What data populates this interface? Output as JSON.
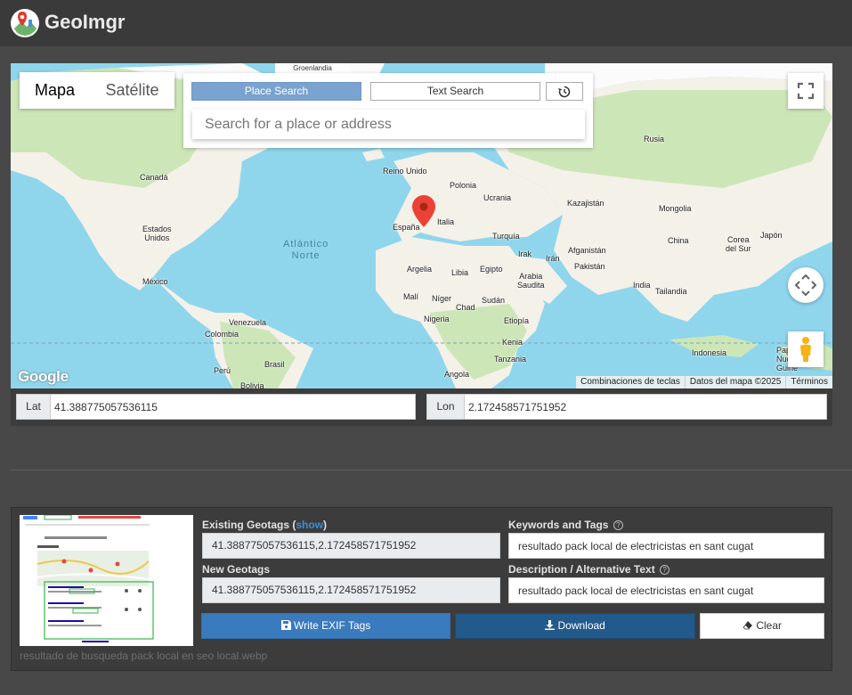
{
  "app": {
    "title": "GeoImgr"
  },
  "map": {
    "map_type": {
      "map": "Mapa",
      "satellite": "Satélite"
    },
    "search": {
      "place_tab": "Place Search",
      "text_tab": "Text Search",
      "history_icon": "history-icon",
      "placeholder": "Search for a place or address"
    },
    "top_label": "Groenlandia",
    "google": "Google",
    "attribution": [
      "Combinaciones de teclas",
      "Datos del mapa ©2025",
      "Términos"
    ],
    "labels": {
      "canada": "Canadá",
      "eeuu": "Estados\nUnidos",
      "mexico": "México",
      "venezuela": "Venezuela",
      "colombia": "Colombia",
      "peru": "Perú",
      "brasil": "Brasil",
      "bolivia": "Bolivia",
      "atlantico": "Atlántico\nNorte",
      "reino_unido": "Reino Unido",
      "polonia": "Polonia",
      "ucrania": "Ucrania",
      "espana": "España",
      "italia": "Italia",
      "turquia": "Turquía",
      "argelia": "Argelia",
      "libia": "Libia",
      "egipto": "Egipto",
      "mali": "Malí",
      "niger": "Níger",
      "chad": "Chad",
      "sudan": "Sudán",
      "nigeria": "Nigeria",
      "etiopia": "Etiopía",
      "kenia": "Kenia",
      "tanzania": "Tanzania",
      "angola": "Angola",
      "irak": "Irak",
      "iran": "Irán",
      "arabia": "Arabia\nSaudita",
      "afganistan": "Afganistán",
      "pakistan": "Pakistán",
      "kazajistan": "Kazajistán",
      "mongolia": "Mongolia",
      "china": "China",
      "corea": "Corea\ndel Sur",
      "japon": "Japón",
      "india": "India",
      "tailandia": "Tailandia",
      "indonesia": "Indonesia",
      "rusia": "Rusia",
      "papua": "Pap\nNue\nGuine"
    },
    "coords": {
      "lat_label": "Lat",
      "lat_value": "41.388775057536115",
      "lon_label": "Lon",
      "lon_value": "2.172458571751952"
    }
  },
  "file": {
    "filename": "resultado de busqueda pack local en seo local.webp",
    "existing_label": "Existing Geotags (",
    "existing_show": "show",
    "existing_close": ")",
    "existing_value": "41.388775057536115,2.172458571751952",
    "new_label": "New Geotags",
    "new_value": "41.388775057536115,2.172458571751952",
    "keywords_label": "Keywords and Tags",
    "keywords_value": "resultado pack local de electricistas en sant cugat",
    "description_label": "Description / Alternative Text",
    "description_value": "resultado pack local de electricistas en sant cugat",
    "write_button": "Write EXIF Tags",
    "download_button": "Download",
    "clear_button": "Clear"
  },
  "colors": {
    "accent": "#3a7bbd",
    "download": "#235a8c",
    "ocean": "#8fd6ec",
    "land": "#f4f1e9",
    "forest": "#cde6b8"
  }
}
